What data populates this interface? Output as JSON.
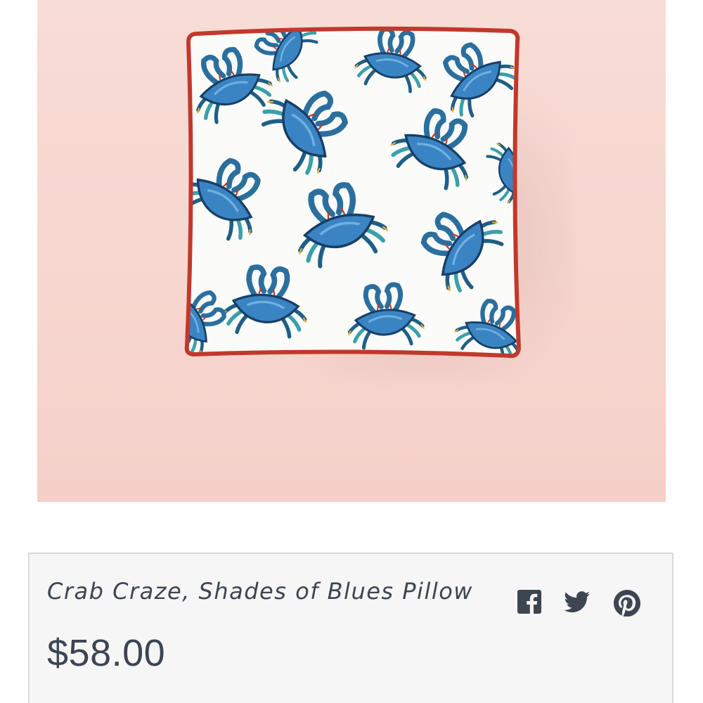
{
  "product": {
    "title": "Crab Craze, Shades of Blues Pillow",
    "price": "$58.00",
    "image_alt": "Crab Craze, Shades of Blues Pillow"
  },
  "share": {
    "icons": [
      "facebook-icon",
      "twitter-icon",
      "pinterest-icon"
    ]
  },
  "colors": {
    "background_pink": "#f7d6cf",
    "piping_red": "#c0392b",
    "crab_blue": "#3b84c4",
    "text": "#3d4552",
    "panel_bg": "#f6f6f6",
    "panel_border": "#d9d9d9"
  }
}
